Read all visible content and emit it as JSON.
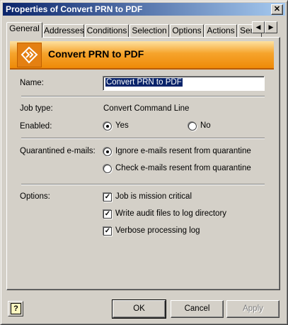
{
  "window": {
    "title": "Properties of Convert PRN to PDF",
    "close_glyph": "✕"
  },
  "tabs": [
    {
      "label": "General"
    },
    {
      "label": "Addresses"
    },
    {
      "label": "Conditions"
    },
    {
      "label": "Selection"
    },
    {
      "label": "Options"
    },
    {
      "label": "Actions"
    },
    {
      "label": "Serv"
    }
  ],
  "tab_scroll": {
    "left_glyph": "◀",
    "right_glyph": "▶"
  },
  "banner": {
    "title": "Convert PRN to PDF",
    "logo_icon": "convert-icon",
    "accent": "#ee8a08"
  },
  "form": {
    "name_label": "Name:",
    "name_value": "Convert PRN to PDF",
    "job_type_label": "Job type:",
    "job_type_value": "Convert Command Line",
    "enabled_label": "Enabled:",
    "enabled_yes": "Yes",
    "enabled_no": "No",
    "quarantine_label": "Quarantined e-mails:",
    "quarantine_ignore": "Ignore e-mails resent from quarantine",
    "quarantine_check": "Check e-mails resent from quarantine",
    "options_label": "Options:",
    "opt_critical": "Job is mission critical",
    "opt_audit": "Write audit files to log directory",
    "opt_verbose": "Verbose processing log",
    "check_glyph": "✓"
  },
  "buttons": {
    "ok": "OK",
    "cancel": "Cancel",
    "apply": "Apply",
    "help_glyph": "?"
  }
}
